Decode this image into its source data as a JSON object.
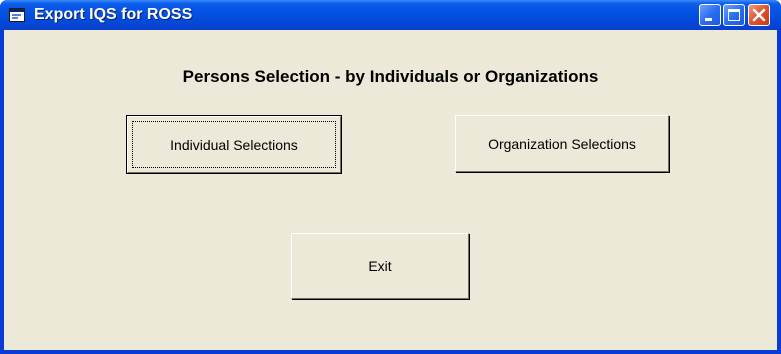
{
  "window": {
    "title": "Export IQS for ROSS",
    "icon": "app-window-icon",
    "controls": [
      "minimize-icon",
      "maximize-icon",
      "close-icon"
    ]
  },
  "form": {
    "heading": "Persons Selection - by Individuals or Organizations",
    "buttons": {
      "individual": "Individual Selections",
      "organization": "Organization Selections",
      "exit": "Exit"
    }
  },
  "colors": {
    "titlebar": "#0552e3",
    "client_background": "#ece9d8",
    "close_button": "#e0532d"
  }
}
